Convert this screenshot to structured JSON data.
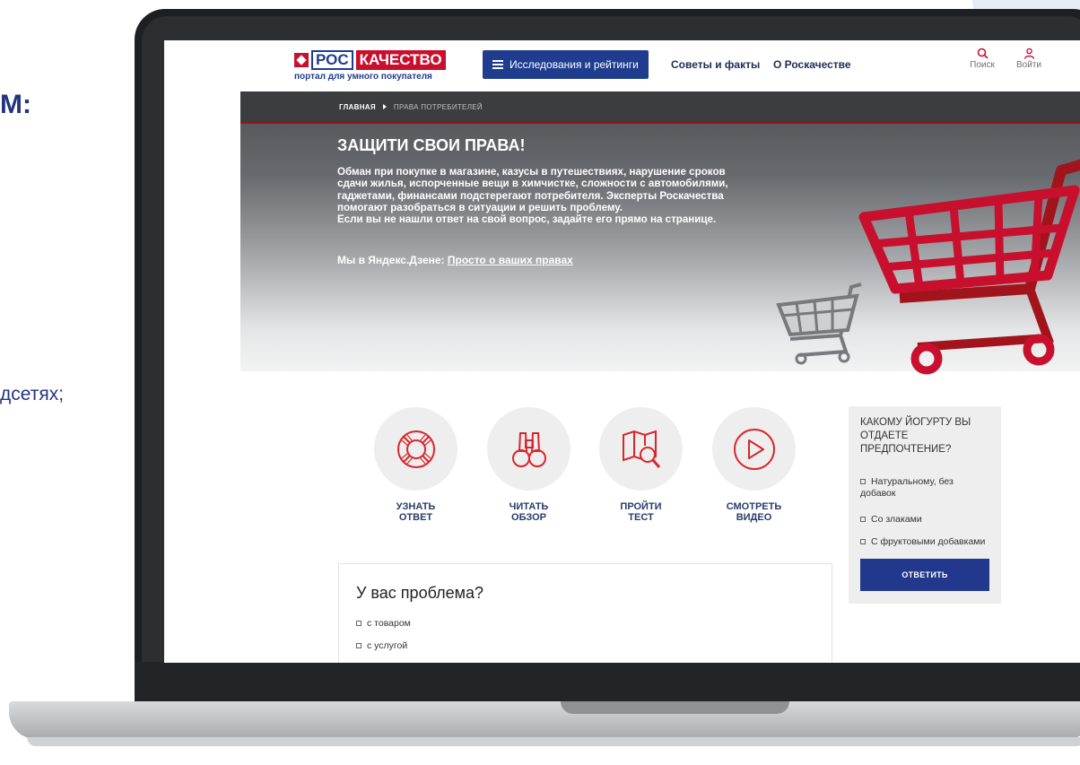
{
  "slide": {
    "fragment_top": "М:",
    "fragment_mid": "дсетях;"
  },
  "header": {
    "logo_ros": "РОС",
    "logo_kach": "КАЧЕСТВО",
    "logo_sub": "портал для умного покупателя",
    "nav_main": "Исследования и рейтинги",
    "nav_tips": "Советы и факты",
    "nav_about": "О Роскачестве",
    "search_label": "Поиск",
    "login_label": "Войти"
  },
  "hero": {
    "crumb_home": "ГЛАВНАЯ",
    "crumb_current": "ПРАВА ПОТРЕБИТЕЛЕЙ",
    "title": "ЗАЩИТИ СВОИ ПРАВА!",
    "lines": [
      "Обман при покупке в магазине, казусы в путешествиях, нарушение сроков",
      "сдачи жилья, испорченные вещи в химчистке, сложности с автомобилями,",
      "гаджетами, финансами подстерегают потребителя. Эксперты Роскачества",
      "помогают разобраться в ситуации и решить проблему.",
      "Если вы не нашли ответ на свой вопрос, задайте его прямо на странице."
    ],
    "dzen_prefix": "Мы в Яндекс.Дзене:",
    "dzen_link": "Просто о ваших правах"
  },
  "actions": [
    {
      "line1": "УЗНАТЬ",
      "line2": "ОТВЕТ"
    },
    {
      "line1": "ЧИТАТЬ",
      "line2": "ОБЗОР"
    },
    {
      "line1": "ПРОЙТИ",
      "line2": "ТЕСТ"
    },
    {
      "line1": "СМОТРЕТЬ",
      "line2": "ВИДЕО"
    }
  ],
  "poll": {
    "question": "Какому йогурту вы отдаете предпочтение?",
    "options": [
      "Натуральному, без добавок",
      "Со злаками",
      "С фруктовыми добавками"
    ],
    "button": "ОТВЕТИТЬ"
  },
  "problem": {
    "title": "У вас проблема?",
    "options": [
      "с товаром",
      "с услугой"
    ]
  },
  "colors": {
    "brand_blue": "#1f3c8f",
    "brand_red": "#c8102e",
    "icon_red": "#d9262d"
  }
}
